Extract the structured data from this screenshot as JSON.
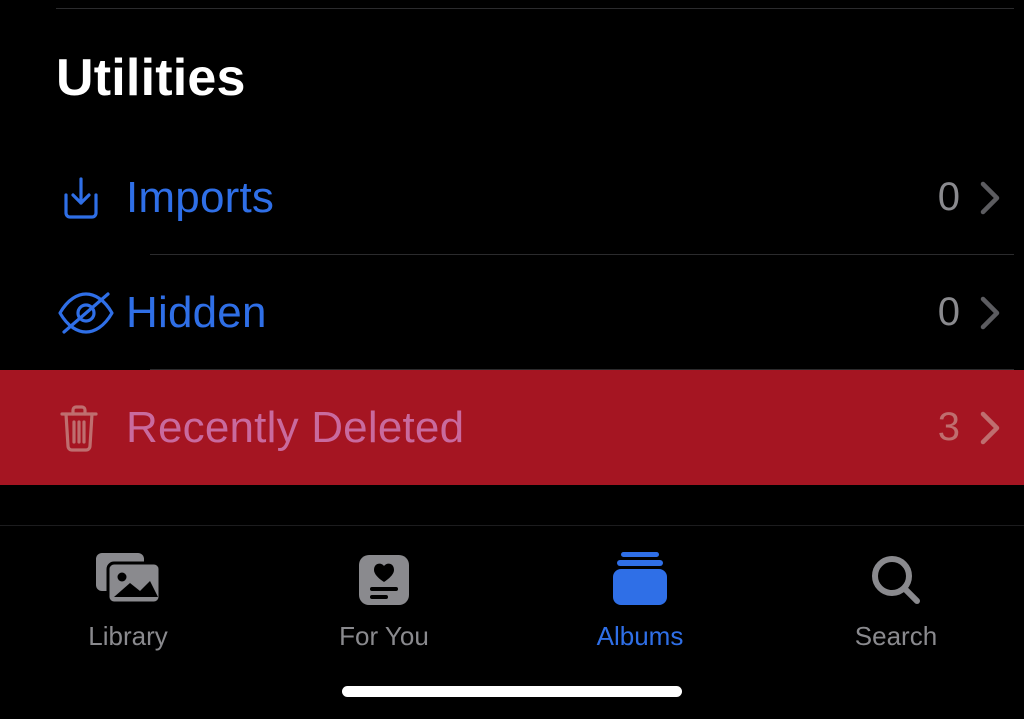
{
  "section": {
    "title": "Utilities"
  },
  "utilities": {
    "items": [
      {
        "label": "Imports",
        "count": "0",
        "icon": "download-box-icon",
        "highlighted": false
      },
      {
        "label": "Hidden",
        "count": "0",
        "icon": "eye-slash-icon",
        "highlighted": false
      },
      {
        "label": "Recently Deleted",
        "count": "3",
        "icon": "trash-icon",
        "highlighted": true
      }
    ]
  },
  "tabs": {
    "items": [
      {
        "label": "Library",
        "icon": "library-icon",
        "active": false
      },
      {
        "label": "For You",
        "icon": "foryou-icon",
        "active": false
      },
      {
        "label": "Albums",
        "icon": "albums-icon",
        "active": true
      },
      {
        "label": "Search",
        "icon": "search-icon",
        "active": false
      }
    ]
  },
  "colors": {
    "accent": "#2f6fe7",
    "highlight_bg": "#a51522",
    "inactive": "#8a8a8e"
  }
}
